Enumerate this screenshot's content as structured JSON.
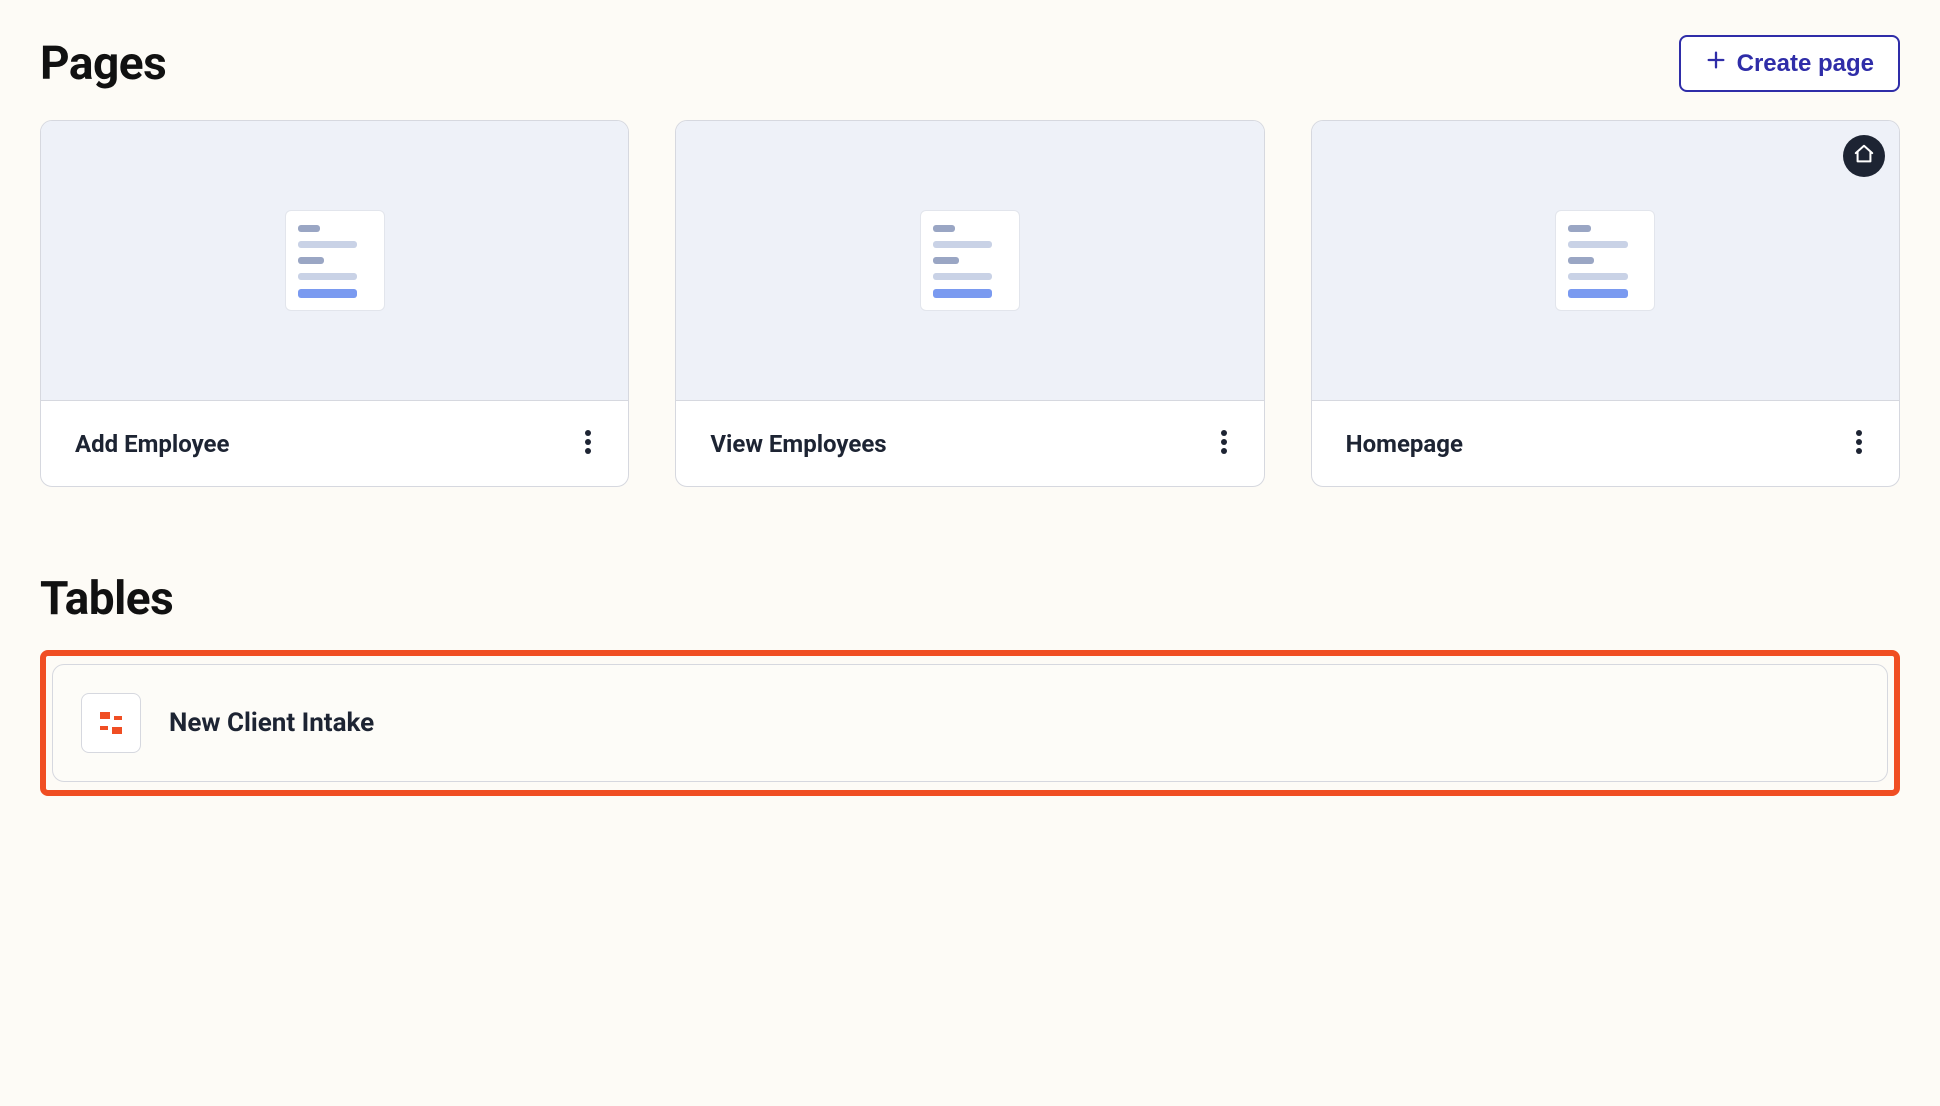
{
  "sections": {
    "pages_title": "Pages",
    "tables_title": "Tables"
  },
  "actions": {
    "create_page_label": "Create page"
  },
  "pages": [
    {
      "name": "Add Employee",
      "is_home": false
    },
    {
      "name": "View Employees",
      "is_home": false
    },
    {
      "name": "Homepage",
      "is_home": true
    }
  ],
  "tables": [
    {
      "name": "New Client Intake"
    }
  ]
}
